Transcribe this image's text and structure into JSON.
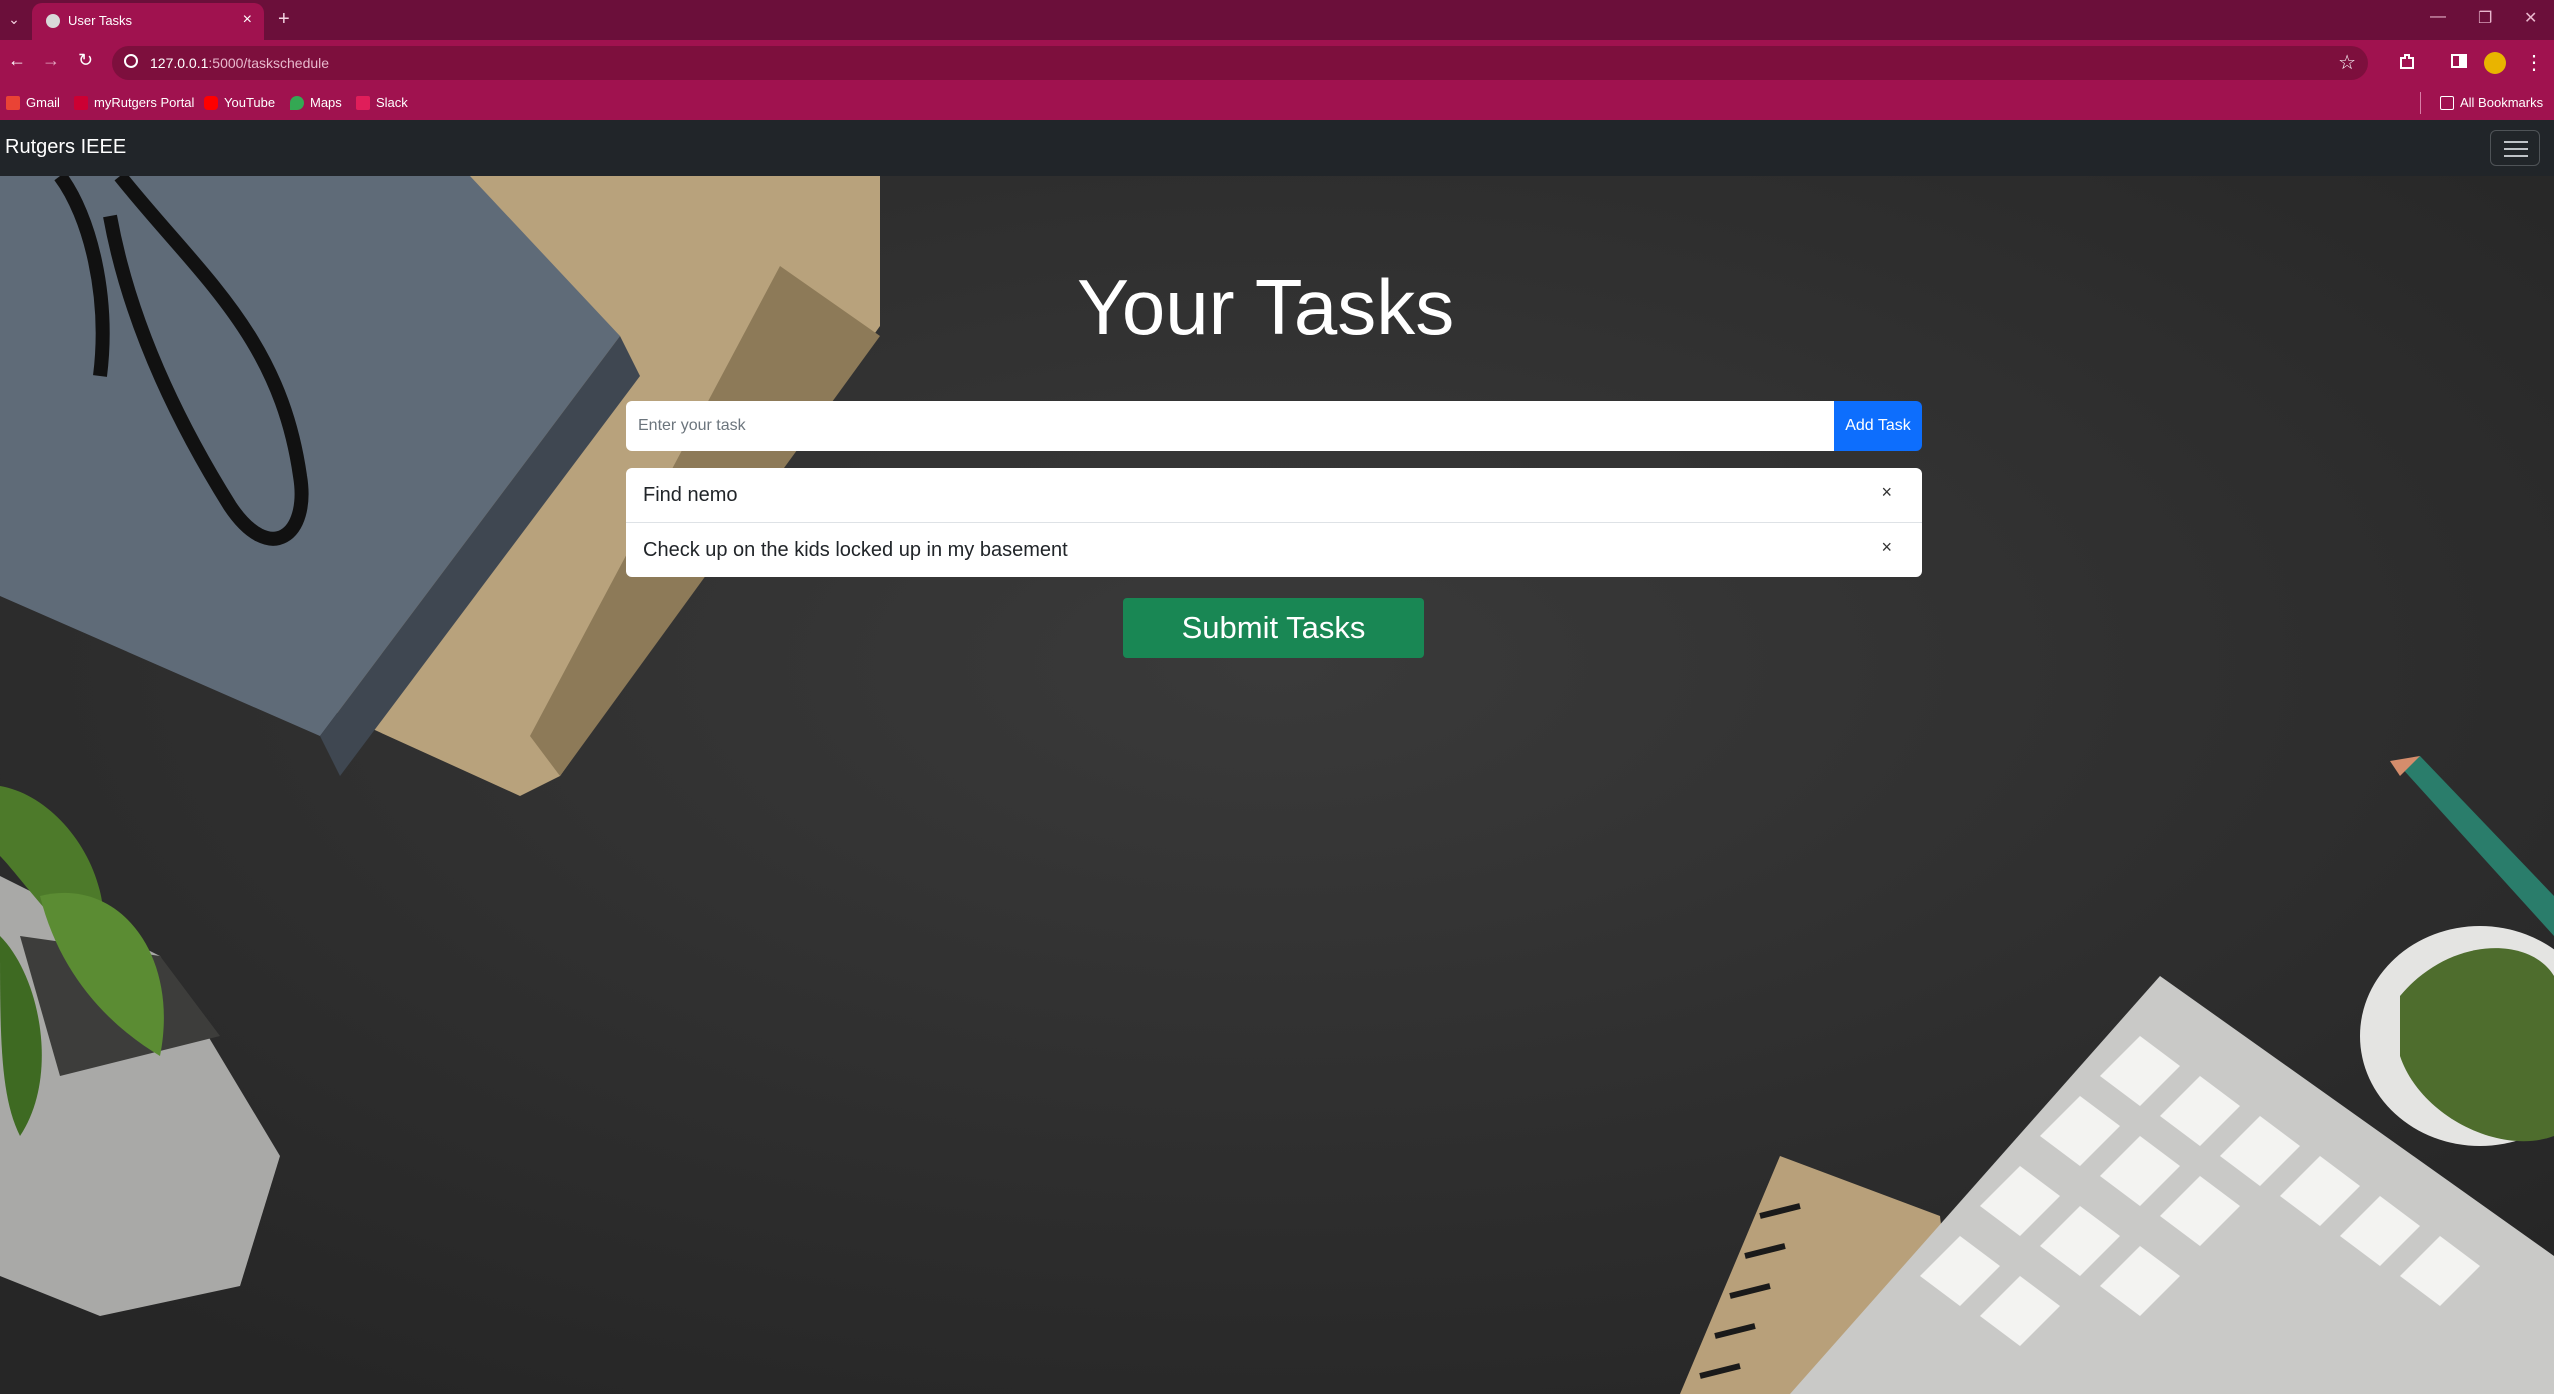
{
  "browser": {
    "tab_title": "User Tasks",
    "tab_close": "×",
    "new_tab": "+",
    "url_host": "127.0.0.1",
    "url_path": ":5000/taskschedule",
    "window_minimize": "—",
    "window_restore": "❐",
    "window_close": "✕"
  },
  "bookmarks": {
    "items": [
      {
        "label": "Gmail",
        "color": "#ea4335"
      },
      {
        "label": "myRutgers Portal",
        "color": "#cc0033"
      },
      {
        "label": "YouTube",
        "color": "#ff0000"
      },
      {
        "label": "Maps",
        "color": "#34a853"
      },
      {
        "label": "Slack",
        "color": "#e01e5a"
      }
    ],
    "all_bookmarks": "All Bookmarks"
  },
  "navbar": {
    "brand": "Rutgers IEEE"
  },
  "main": {
    "heading": "Your Tasks",
    "input_placeholder": "Enter your task",
    "add_label": "Add Task",
    "tasks": [
      {
        "text": "Find nemo",
        "remove": "×"
      },
      {
        "text": "Check up on the kids locked up in my basement",
        "remove": "×"
      }
    ],
    "submit_label": "Submit Tasks"
  },
  "colors": {
    "tab_strip": "#6b0f3a",
    "toolbar": "#a0124f",
    "navbar": "#212529",
    "add_button": "#0d6efd",
    "submit_button": "#198754"
  }
}
